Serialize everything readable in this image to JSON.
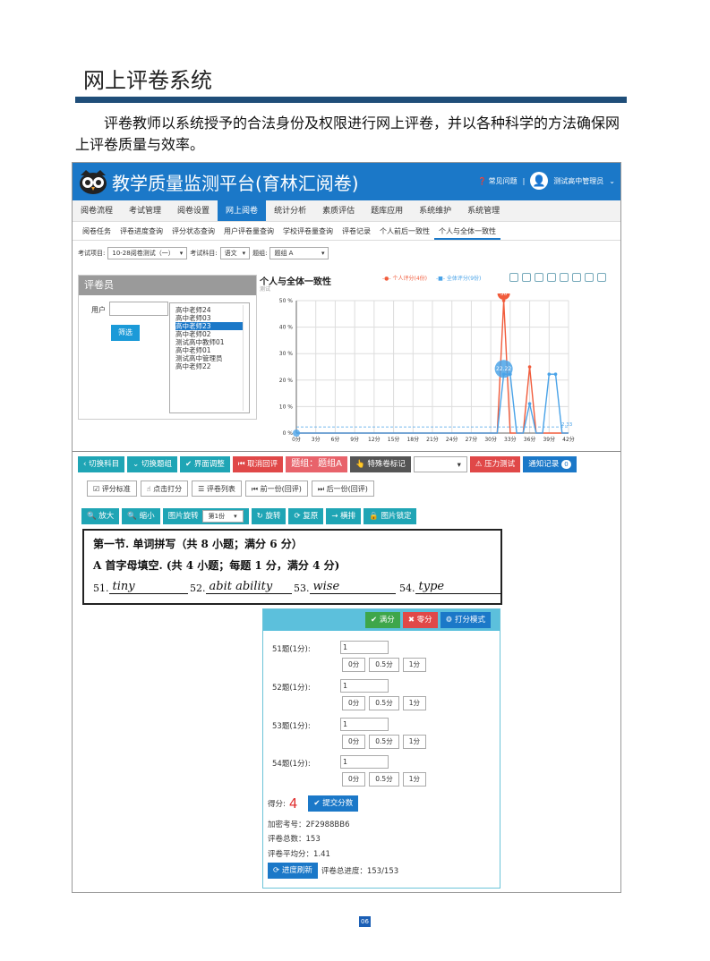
{
  "doc": {
    "title": "网上评卷系统",
    "intro": "评卷教师以系统授予的合法身份及权限进行网上评卷，并以各种科学的方法确保网上评卷质量与效率。",
    "page_number": "06"
  },
  "app": {
    "title": "教学质量监测平台(育林汇阅卷)",
    "help": "常见问题",
    "user": "测试高中管理员"
  },
  "menu": [
    "阅卷流程",
    "考试管理",
    "阅卷设置",
    "网上阅卷",
    "统计分析",
    "素质评估",
    "题库应用",
    "系统维护",
    "系统管理"
  ],
  "submenu": [
    "阅卷任务",
    "评卷进度查询",
    "评分状态查询",
    "用户评卷量查询",
    "学校评卷量查询",
    "评卷记录",
    "个人前后一致性",
    "个人与全体一致性"
  ],
  "filters": {
    "project_label": "考试项目:",
    "project_value": "10-28阅卷测试（一）",
    "subject_label": "考试科目:",
    "subject_value": "语文",
    "group_label": "题组:",
    "group_value": "题组 A"
  },
  "reviewer_panel": {
    "title": "评卷员",
    "user_label": "用户",
    "filter_button": "筛选",
    "users": [
      "高中老师24",
      "高中老师03",
      "高中老师23",
      "高中老师02",
      "测试高中教师01",
      "高中老师01",
      "测试高中管理员",
      "高中老师22"
    ],
    "selected_index": 2
  },
  "chart_data": {
    "type": "line",
    "title": "个人与全体一致性",
    "subtitle": "测试",
    "x": [
      "0分",
      "3分",
      "6分",
      "9分",
      "12分",
      "15分",
      "18分",
      "21分",
      "24分",
      "27分",
      "30分",
      "33分",
      "36分",
      "39分",
      "42分"
    ],
    "x_values": [
      0,
      1,
      2,
      3,
      4,
      5,
      6,
      7,
      8,
      9,
      10,
      11,
      12,
      13,
      14,
      15,
      16,
      17,
      18,
      19,
      20,
      21,
      22,
      23,
      24,
      25,
      26,
      27,
      28,
      29,
      30,
      31,
      32,
      33,
      34,
      35,
      36,
      37,
      38,
      39,
      40,
      41,
      42
    ],
    "ylim": [
      0,
      50
    ],
    "yticks": [
      "0 %",
      "10 %",
      "20 %",
      "30 %",
      "40 %",
      "50 %"
    ],
    "series": [
      {
        "name": "个人评分(4份)",
        "color": "#f15c3c",
        "values": [
          0,
          0,
          0,
          0,
          0,
          0,
          0,
          0,
          0,
          0,
          0,
          0,
          0,
          0,
          0,
          0,
          0,
          0,
          0,
          0,
          0,
          0,
          0,
          0,
          0,
          0,
          0,
          0,
          0,
          0,
          0,
          0,
          50,
          0,
          0,
          0,
          25,
          0,
          0,
          0,
          0,
          0,
          0
        ]
      },
      {
        "name": "全体评分(9份)",
        "color": "#4aa3e8",
        "values": [
          0,
          0,
          0,
          0,
          0,
          0,
          0,
          0,
          0,
          0,
          0,
          0,
          0,
          0,
          0,
          0,
          0,
          0,
          0,
          0,
          0,
          0,
          0,
          0,
          0,
          0,
          0,
          0,
          0,
          0,
          0,
          0,
          22.22,
          22.22,
          0,
          0,
          11.11,
          0,
          0,
          22.22,
          22.22,
          0,
          0
        ]
      }
    ],
    "labels": {
      "peak_personal": "50",
      "peak_all": "22.22",
      "mean_line": "2.33"
    }
  },
  "toolbar1": [
    "切换科目",
    "切换题组",
    "界面调整",
    "取消回评",
    "题组：题组A",
    "特殊卷标记",
    "压力测试",
    "通知记录"
  ],
  "notify_count": "0",
  "toolbar2": [
    "评分标准",
    "点击打分",
    "评卷列表",
    "前一份(回评)",
    "后一份(回评)"
  ],
  "toolbar3": {
    "zoom_in": "放大",
    "zoom_out": "缩小",
    "rotate_label": "图片旋转",
    "rotate_value": "第1份",
    "rotate": "旋转",
    "reset": "复原",
    "arrange": "横排",
    "lock": "图片锁定"
  },
  "paper": {
    "line1": "第一节. 单词拼写（共 8 小题；满分 6 分）",
    "line2": "A 首字母填空. (共 4 小题；每题 1 分，满分 4 分)",
    "answers": [
      {
        "num": "51.",
        "text": "tiny"
      },
      {
        "num": "52.",
        "text": "abit ability"
      },
      {
        "num": "53.",
        "text": "wise"
      },
      {
        "num": "54.",
        "text": "type"
      }
    ]
  },
  "score_panel": {
    "full": "满分",
    "zero": "零分",
    "mode": "打分模式",
    "questions": [
      {
        "label": "51题(1分):",
        "value": "1"
      },
      {
        "label": "52题(1分):",
        "value": "1"
      },
      {
        "label": "53题(1分):",
        "value": "1"
      },
      {
        "label": "54题(1分):",
        "value": "1"
      }
    ],
    "options": [
      "0分",
      "0.5分",
      "1分"
    ],
    "score_label": "得分:",
    "score_value": "4",
    "submit": "提交分数",
    "code": "加密考号：2F2988BB6",
    "total": "评卷总数：153",
    "avg": "评卷平均分：1.41",
    "refresh": "进度刷新",
    "progress": "评卷总进度：153/153"
  }
}
